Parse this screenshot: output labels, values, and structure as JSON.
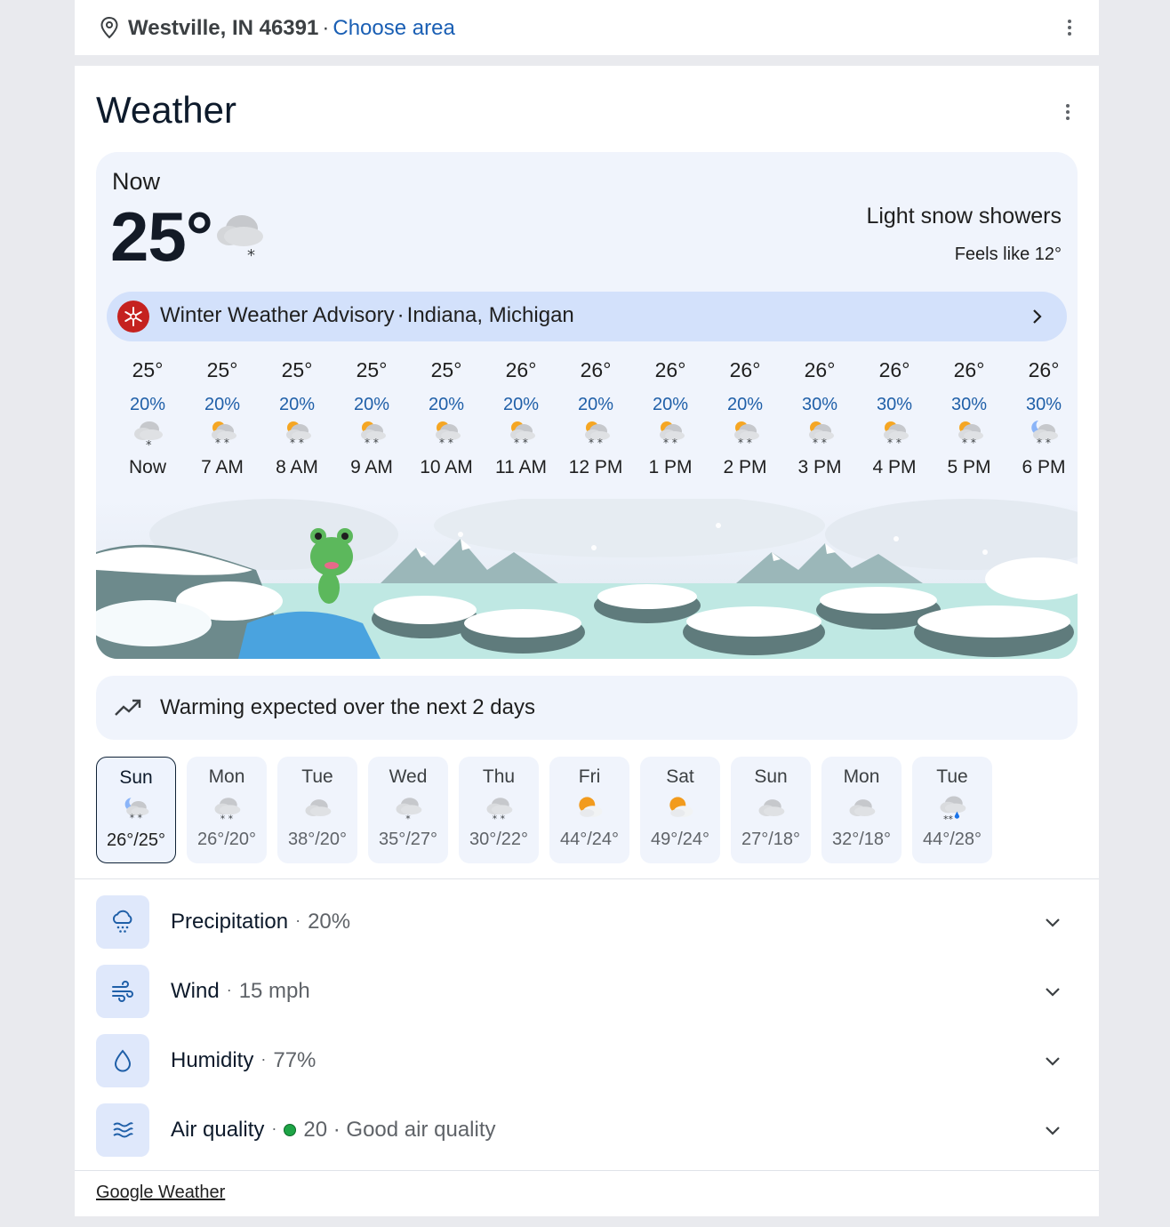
{
  "location": {
    "place": "Westville, IN 46391",
    "separator": "·",
    "choose_area": "Choose area"
  },
  "weather": {
    "title": "Weather",
    "now": {
      "label": "Now",
      "temp": "25°",
      "condition": "Light snow showers",
      "feels_like": "Feels like 12°",
      "icon": "snow-cloud-icon"
    },
    "advisory": {
      "title": "Winter Weather Advisory",
      "separator": "·",
      "region": "Indiana, Michigan",
      "icon": "snowflake-icon",
      "color": "#c5221f"
    },
    "hourly": [
      {
        "temp": "25°",
        "precip": "20%",
        "label": "Now",
        "icon": "cloud-snow-icon"
      },
      {
        "temp": "25°",
        "precip": "20%",
        "label": "7 AM",
        "icon": "sun-cloud-snow-icon"
      },
      {
        "temp": "25°",
        "precip": "20%",
        "label": "8 AM",
        "icon": "sun-cloud-snow-icon"
      },
      {
        "temp": "25°",
        "precip": "20%",
        "label": "9 AM",
        "icon": "sun-cloud-snow-icon"
      },
      {
        "temp": "25°",
        "precip": "20%",
        "label": "10 AM",
        "icon": "sun-cloud-snow-icon"
      },
      {
        "temp": "26°",
        "precip": "20%",
        "label": "11 AM",
        "icon": "sun-cloud-snow-icon"
      },
      {
        "temp": "26°",
        "precip": "20%",
        "label": "12 PM",
        "icon": "sun-cloud-snow-icon"
      },
      {
        "temp": "26°",
        "precip": "20%",
        "label": "1 PM",
        "icon": "sun-cloud-snow-icon"
      },
      {
        "temp": "26°",
        "precip": "20%",
        "label": "2 PM",
        "icon": "sun-cloud-snow-icon"
      },
      {
        "temp": "26°",
        "precip": "30%",
        "label": "3 PM",
        "icon": "sun-cloud-snow-icon"
      },
      {
        "temp": "26°",
        "precip": "30%",
        "label": "4 PM",
        "icon": "sun-cloud-snow-icon"
      },
      {
        "temp": "26°",
        "precip": "30%",
        "label": "5 PM",
        "icon": "sun-cloud-snow-icon"
      },
      {
        "temp": "26°",
        "precip": "30%",
        "label": "6 PM",
        "icon": "moon-cloud-snow-icon"
      }
    ],
    "trend": {
      "text": "Warming expected over the next 2 days",
      "icon": "trending-up-icon"
    },
    "daily": [
      {
        "day": "Sun",
        "hilo": "26°/25°",
        "icon": "moon-cloud-snow-icon",
        "selected": true
      },
      {
        "day": "Mon",
        "hilo": "26°/20°",
        "icon": "cloud-snow-icon"
      },
      {
        "day": "Tue",
        "hilo": "38°/20°",
        "icon": "cloud-icon"
      },
      {
        "day": "Wed",
        "hilo": "35°/27°",
        "icon": "cloud-snow-icon"
      },
      {
        "day": "Thu",
        "hilo": "30°/22°",
        "icon": "cloud-snow-icon"
      },
      {
        "day": "Fri",
        "hilo": "44°/24°",
        "icon": "sun-cloud-icon"
      },
      {
        "day": "Sat",
        "hilo": "49°/24°",
        "icon": "sun-cloud-icon"
      },
      {
        "day": "Sun",
        "hilo": "27°/18°",
        "icon": "cloud-icon"
      },
      {
        "day": "Mon",
        "hilo": "32°/18°",
        "icon": "cloud-icon"
      },
      {
        "day": "Tue",
        "hilo": "44°/28°",
        "icon": "cloud-rain-snow-icon"
      }
    ],
    "metrics": [
      {
        "name": "Precipitation",
        "value": "20%",
        "icon": "precipitation-icon"
      },
      {
        "name": "Wind",
        "value": "15 mph",
        "icon": "wind-icon"
      },
      {
        "name": "Humidity",
        "value": "77%",
        "icon": "humidity-icon"
      },
      {
        "name": "Air quality",
        "value": "20 · Good air quality",
        "icon": "air-quality-icon",
        "status_color": "#1ea446"
      }
    ],
    "metric_separator": "·",
    "footer": "Google Weather"
  },
  "colors": {
    "accent_link": "#1a5fb4",
    "panel_bg": "#f0f4fc",
    "advisory_bg": "#d3e1fb",
    "precip_text": "#1f5fa8"
  }
}
